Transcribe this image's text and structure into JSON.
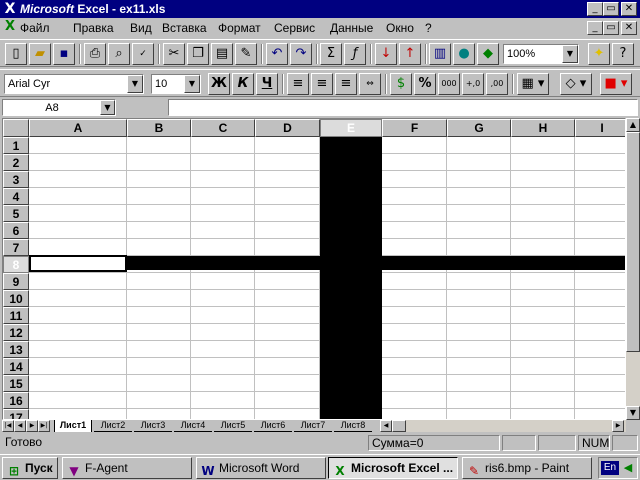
{
  "window": {
    "brand": "Microsoft",
    "title_rest": " Excel - ex11.xls",
    "buttons": {
      "minimize": "_",
      "restore": "▭",
      "close": "✕"
    }
  },
  "menu": {
    "items": [
      "Файл",
      "Правка",
      "Вид",
      "Вставка",
      "Формат",
      "Сервис",
      "Данные",
      "Окно",
      "?"
    ],
    "doc_buttons": {
      "minimize": "_",
      "restore": "▭",
      "close": "✕"
    }
  },
  "standard_toolbar": {
    "zoom": "100%"
  },
  "format_toolbar": {
    "font": "Arial Cyr",
    "size": "10",
    "bold": "Ж",
    "italic": "К",
    "underline": "Ч",
    "percent": "%",
    "thousands": "000",
    "inc_decimal": "+,0",
    "dec_decimal": ",00"
  },
  "formula_bar": {
    "name_box": "A8",
    "formula": ""
  },
  "grid": {
    "columns": [
      "A",
      "B",
      "C",
      "D",
      "E",
      "F",
      "G",
      "H",
      "I"
    ],
    "rows": [
      "1",
      "2",
      "3",
      "4",
      "5",
      "6",
      "7",
      "8",
      "9",
      "10",
      "11",
      "12",
      "13",
      "14",
      "15",
      "16",
      "17"
    ],
    "selected_column": "E",
    "selected_row": "8",
    "active_cell": "A8"
  },
  "sheets": {
    "tabs": [
      "Лист1",
      "Лист2",
      "Лист3",
      "Лист4",
      "Лист5",
      "Лист6",
      "Лист7",
      "Лист8"
    ],
    "active": "Лист1"
  },
  "status": {
    "ready": "Готово",
    "sum": "Сумма=0",
    "num": "NUM"
  },
  "taskbar": {
    "start": "Пуск",
    "tasks": [
      "F-Agent",
      "Microsoft Word",
      "Microsoft Excel ...",
      "ris6.bmp - Paint"
    ],
    "active_task": "Microsoft Excel ...",
    "lang": "En"
  },
  "colors": {
    "title_bg": "#000080",
    "face": "#c0c0c0",
    "selection": "#000000"
  }
}
